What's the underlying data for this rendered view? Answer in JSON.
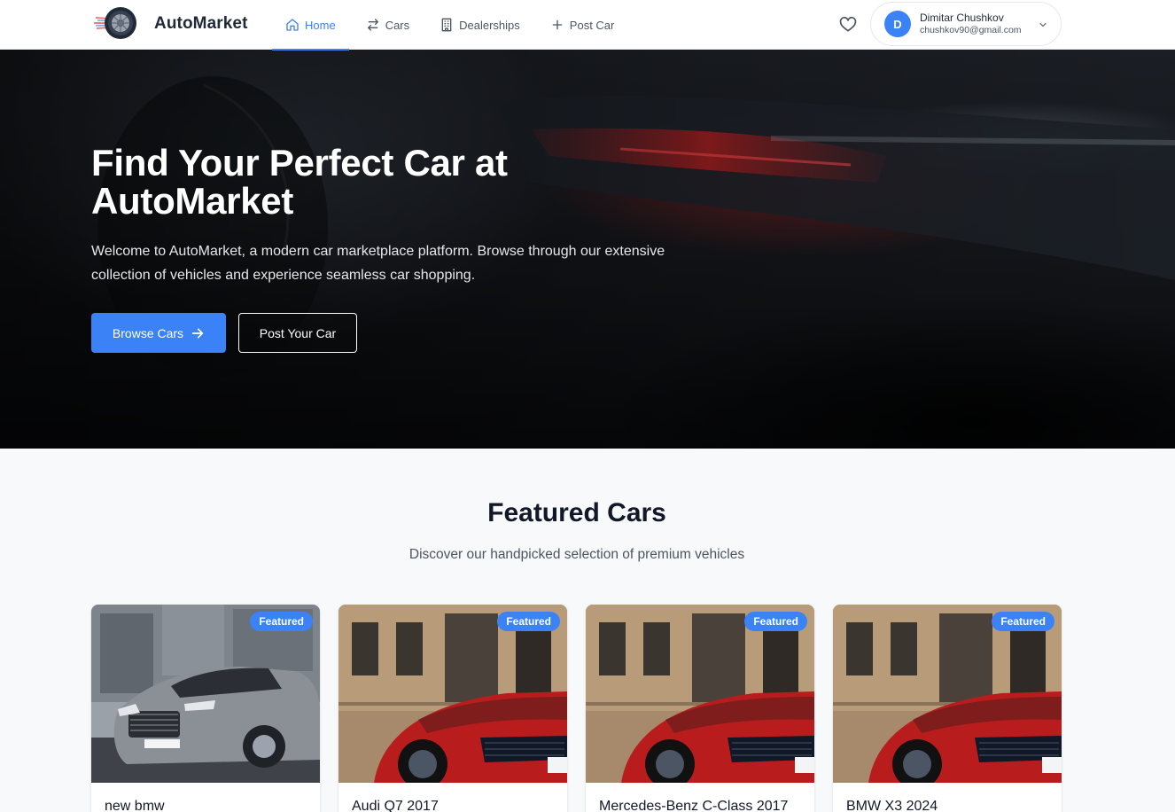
{
  "brand": {
    "name": "AutoMarket"
  },
  "nav": {
    "items": [
      {
        "label": "Home",
        "icon": "home-icon",
        "active": true
      },
      {
        "label": "Cars",
        "icon": "arrows-swap-icon",
        "active": false
      },
      {
        "label": "Dealerships",
        "icon": "building-icon",
        "active": false
      },
      {
        "label": "Post Car",
        "icon": "plus-icon",
        "active": false
      }
    ]
  },
  "user": {
    "initial": "D",
    "name": "Dimitar Chushkov",
    "email": "chushkov90@gmail.com"
  },
  "hero": {
    "title": "Find Your Perfect Car at AutoMarket",
    "subtitle": "Welcome to AutoMarket, a modern car marketplace platform. Browse through our extensive collection of vehicles and experience seamless car shopping.",
    "primary_cta": "Browse Cars",
    "secondary_cta": "Post Your Car"
  },
  "featured": {
    "title": "Featured Cars",
    "subtitle": "Discover our handpicked selection of premium vehicles",
    "badge": "Featured",
    "cards": [
      {
        "title": "new bmw",
        "image": "silver-sedan"
      },
      {
        "title": "Audi Q7 2017",
        "image": "red-sportscar"
      },
      {
        "title": "Mercedes-Benz C-Class 2017",
        "image": "red-sportscar"
      },
      {
        "title": "BMW X3 2024",
        "image": "red-sportscar"
      }
    ]
  },
  "colors": {
    "accent": "#3b82f6",
    "text": "#111827",
    "muted": "#4b5563",
    "background": "#f8f9fb"
  }
}
